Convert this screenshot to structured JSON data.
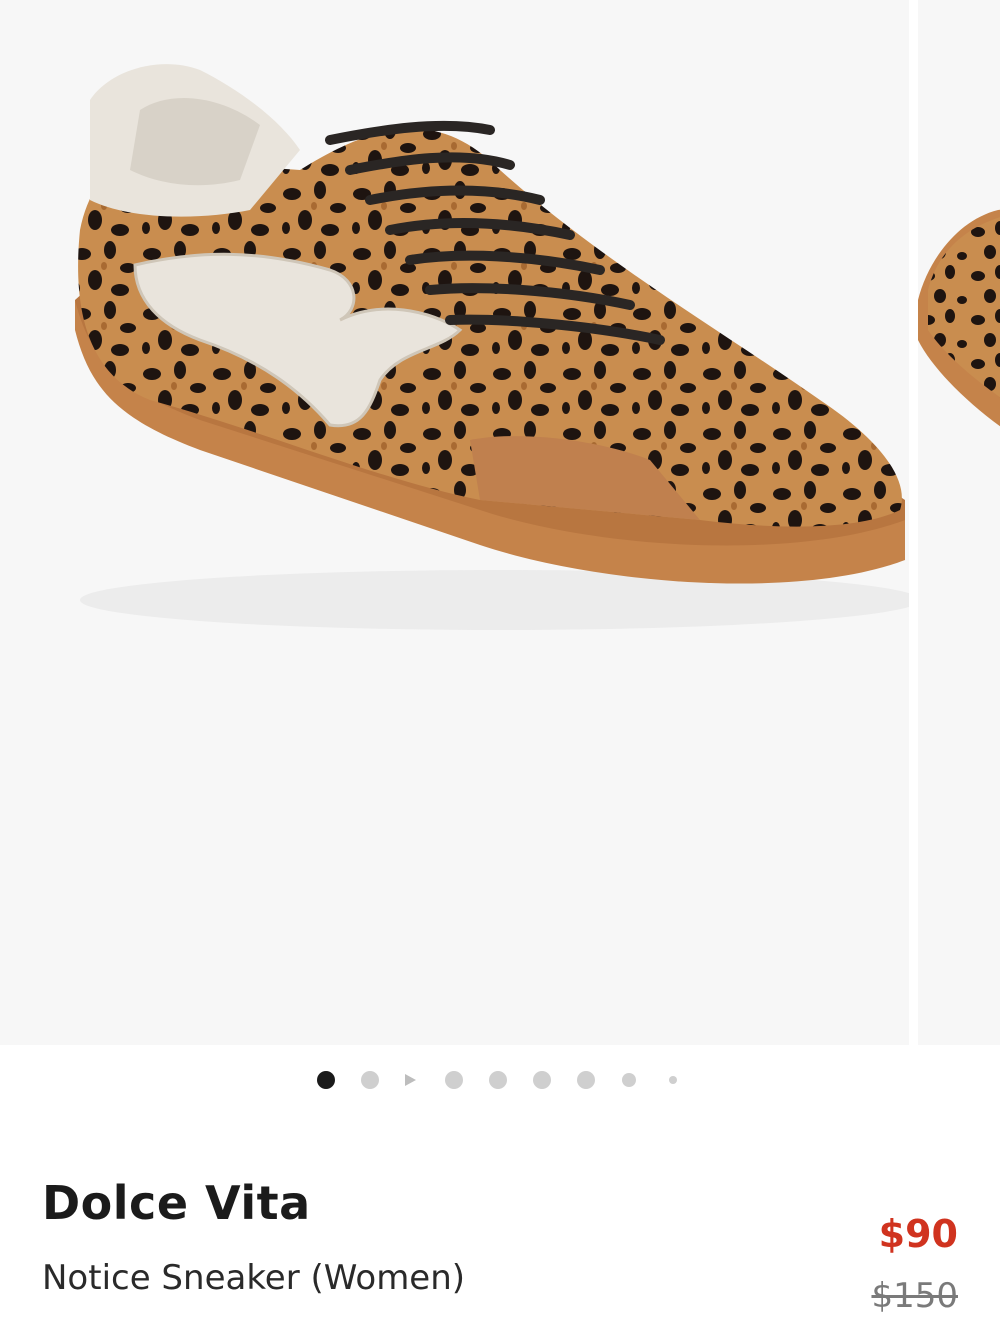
{
  "product": {
    "brand": "Dolce Vita",
    "name": "Notice Sneaker (Women)",
    "price_sale": "$90",
    "price_original": "$150"
  },
  "gallery": {
    "image_subject": "leopard-print-sneaker",
    "slide_count": 9,
    "active_index": 0,
    "video_slide_index": 2
  },
  "colors": {
    "sale_price": "#d0331f",
    "active_dot": "#1a1a1a",
    "inactive_dot": "#cfcfcf"
  }
}
